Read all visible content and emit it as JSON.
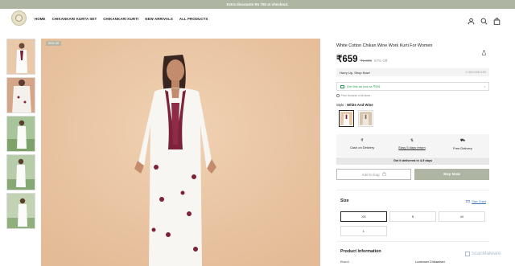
{
  "announcement": "Extra discounts Rs 750 at checkout.",
  "nav": {
    "items": [
      "HOME",
      "CHIKANKARI KURTA SET",
      "CHIKANKARI KURTI",
      "NEW ARRIVALS",
      "ALL PRODUCTS"
    ]
  },
  "header_icons": [
    "user-icon",
    "search-icon",
    "bag-icon"
  ],
  "gallery": {
    "badge": "80% Off",
    "thumbnail_count": 5
  },
  "product": {
    "title": "White Cotton Chikan Wine Work Kurti For Women",
    "price": "₹659",
    "mrp": "₹1,999",
    "discount": "67% Off",
    "hurry_text": "Hurry Up, Shop Now!",
    "hurry_timer": "⏱ 00H:03M:15S",
    "offer_text": "Get this as low as ₹591",
    "tax_note": "Price Inclusive of all taxes",
    "style_label": "Style :",
    "style_value": "White And Wine"
  },
  "features": [
    {
      "icon": "₹",
      "label": "Cash on Delivery"
    },
    {
      "icon": "⇅",
      "label": "Easy 5 days return"
    },
    {
      "icon": "⛟",
      "label": "Free Delivery"
    }
  ],
  "delivery_note": "Get it delivered in 4-9 days",
  "actions": {
    "add_to_bag": "Add to bag",
    "buy_now": "Buy Now"
  },
  "size": {
    "label": "Size",
    "chart_link": "Size Chart",
    "options": [
      "XS",
      "S",
      "M",
      "L"
    ],
    "selected": "XS"
  },
  "product_information": {
    "title": "Product Information",
    "brand_key": "Brand",
    "brand_value": "Lucknowi Chikankari"
  },
  "watermark": "ScanMalware",
  "colors": {
    "accent": "#aeb5a3",
    "offer_green": "#2e9b4b",
    "photo_bg": "#eac7a6"
  }
}
